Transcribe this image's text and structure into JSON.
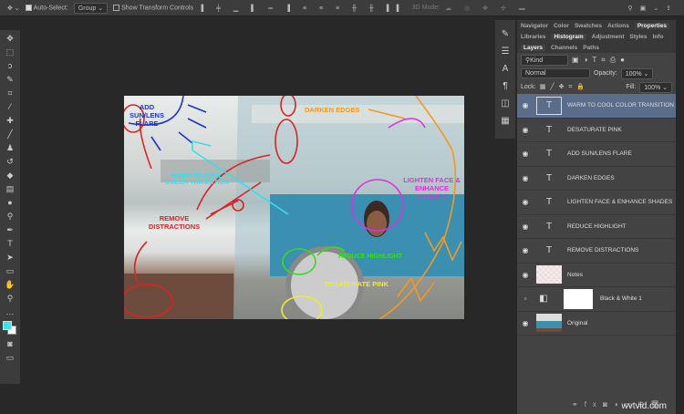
{
  "toolbar": {
    "auto_select_label": "Auto-Select:",
    "auto_select_value": "Group",
    "transform_label": "Show Transform Controls",
    "mode_3d": "3D Mode:"
  },
  "panel": {
    "tabs_row1": [
      "Navigator",
      "Color",
      "Swatches",
      "Actions",
      "Properties"
    ],
    "tabs_row2": [
      "Libraries",
      "Histogram",
      "Adjustment",
      "Styles",
      "Info"
    ],
    "tabs_row3": [
      "Layers",
      "Channels",
      "Paths"
    ],
    "filter": "Kind",
    "blend": "Normal",
    "opacity_label": "Opacity:",
    "opacity": "100%",
    "lock_label": "Lock:",
    "fill_label": "Fill:",
    "fill": "100%"
  },
  "layers": [
    {
      "name": "WARM TO COOL COLOR TRANSITION",
      "type": "text",
      "selected": true
    },
    {
      "name": "DESATURATE PINK",
      "type": "text"
    },
    {
      "name": "ADD SUN/LENS FLARE",
      "type": "text"
    },
    {
      "name": "DARKEN EDGES",
      "type": "text"
    },
    {
      "name": "LIGHTEN FACE & ENHANCE SHADES",
      "type": "text"
    },
    {
      "name": "REDUCE HIGHLIGHT",
      "type": "text"
    },
    {
      "name": "REMOVE  DISTRACTIONS",
      "type": "text"
    },
    {
      "name": "Notes",
      "type": "raster"
    },
    {
      "name": "Black & White 1",
      "type": "adjustment",
      "hidden": true
    },
    {
      "name": "Original",
      "type": "photo"
    }
  ],
  "annotations": {
    "sun": "ADD SUN/LENS FLARE",
    "darken": "DARKEN EDGES",
    "warm": "WARM TO COOL COLOR TRANSITION",
    "lighten": "LIGHTEN FACE & ENHANCE SHADES",
    "remove": "REMOVE DISTRACTIONS",
    "reduce": "REDUCE HIGHLIGHT",
    "desat": "DESATURATE PINK"
  },
  "colors": {
    "foreground": "#33e6f0",
    "background": "#ffffff",
    "selected": "#5a6d8a"
  },
  "watermark": "wvtvid.com"
}
